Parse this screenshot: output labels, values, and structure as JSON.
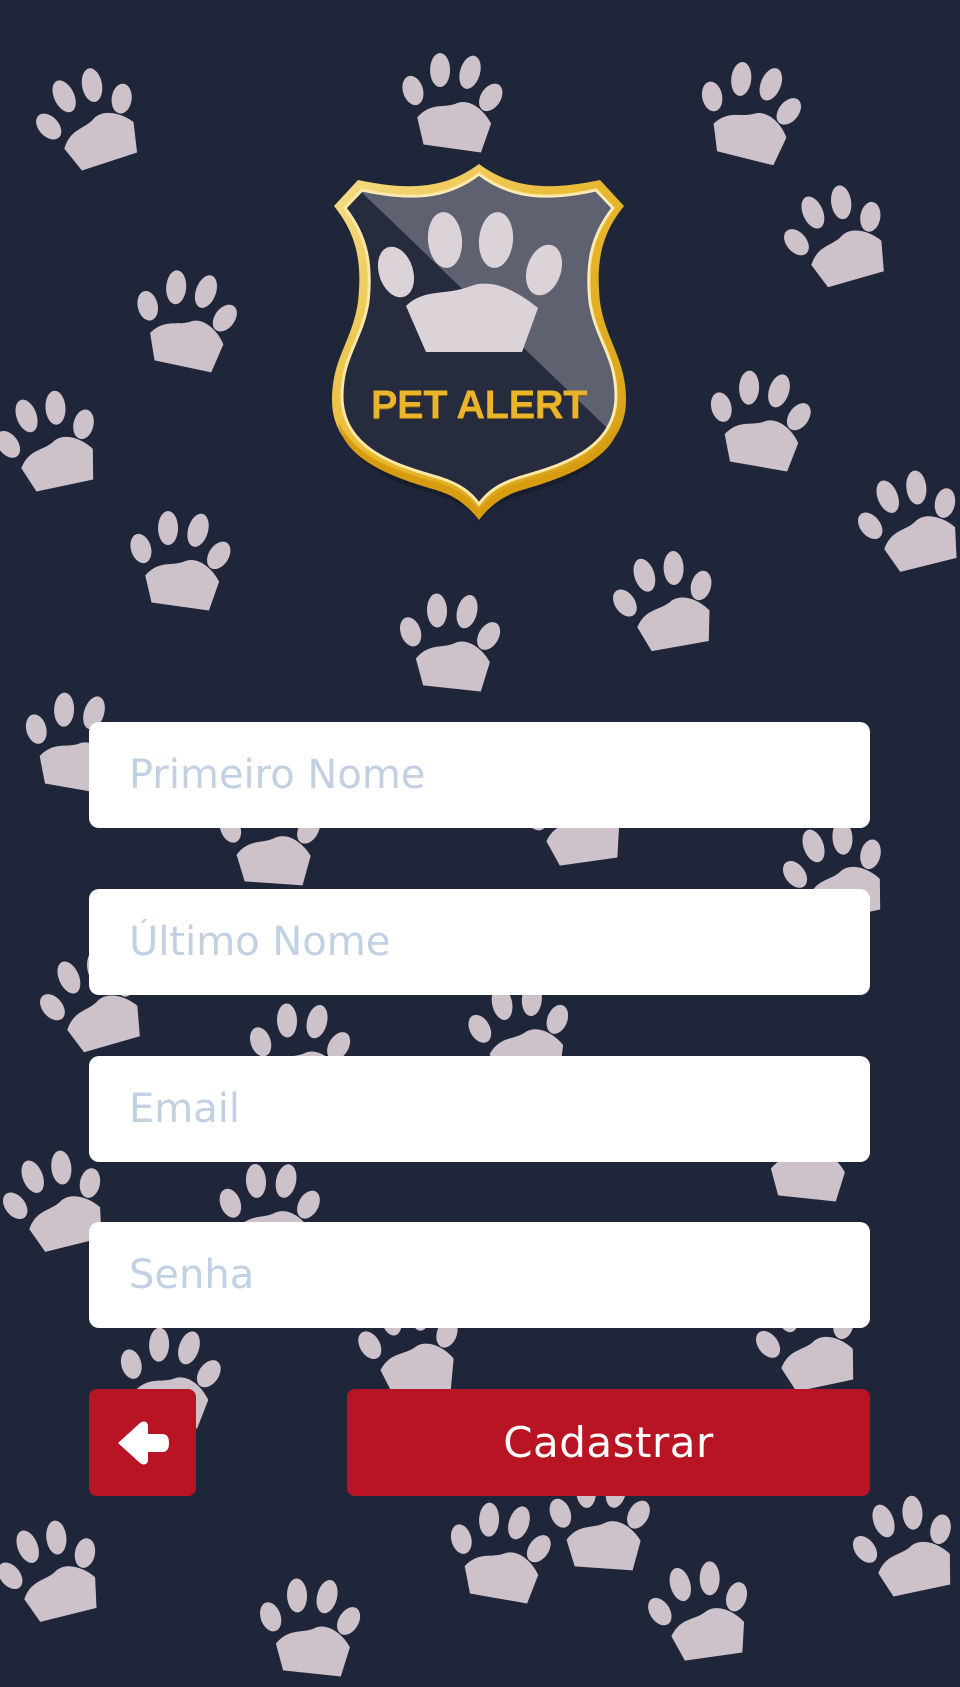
{
  "app": {
    "name": "PET ALERT",
    "logo_icon": "police-shield-paw-badge",
    "background_icon": "paw-print"
  },
  "form": {
    "first_name": {
      "placeholder": "Primeiro Nome",
      "value": ""
    },
    "last_name": {
      "placeholder": "Último Nome",
      "value": ""
    },
    "email": {
      "placeholder": "Email",
      "value": ""
    },
    "password": {
      "placeholder": "Senha",
      "value": ""
    }
  },
  "actions": {
    "back_icon": "arrow-left-icon",
    "submit_label": "Cadastrar"
  },
  "colors": {
    "background": "#202639",
    "paw": "#cdc2c9",
    "badge_gold": "#eab52a",
    "button_red": "#b91423",
    "placeholder": "#c2d0e3"
  }
}
